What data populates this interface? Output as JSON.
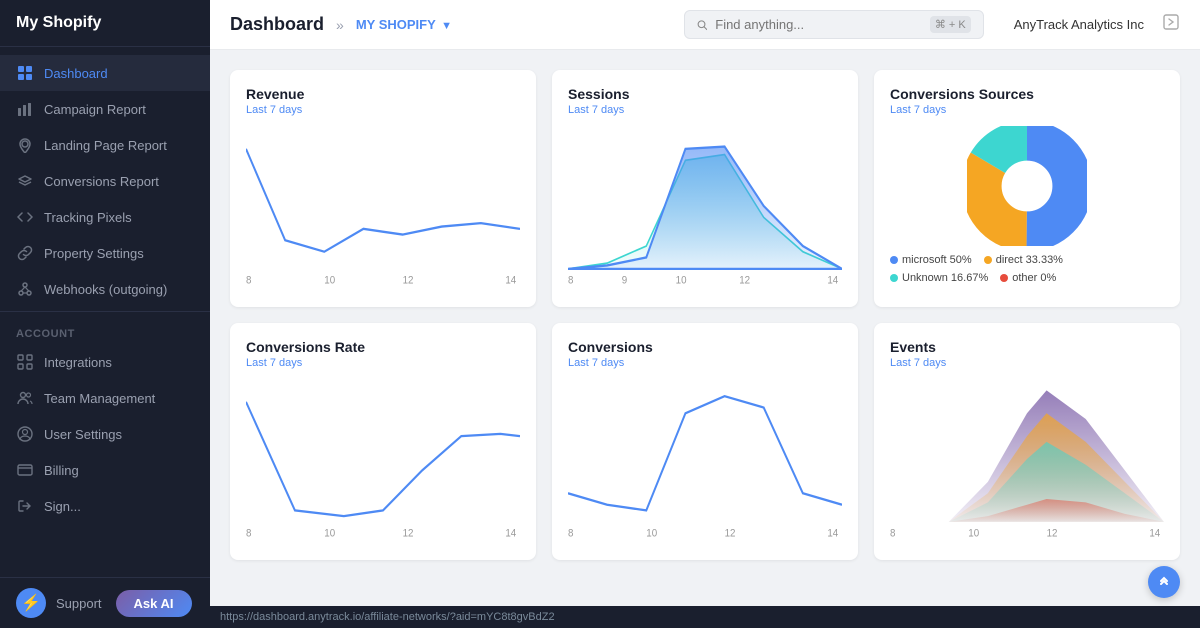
{
  "app": {
    "name": "My Shopify"
  },
  "topbar": {
    "title": "Dashboard",
    "breadcrumb": "MY SHOPIFY",
    "search_placeholder": "Find anything...",
    "search_shortcut": "⌘ + K",
    "user": "AnyTrack Analytics Inc"
  },
  "sidebar": {
    "nav_items": [
      {
        "id": "dashboard",
        "label": "Dashboard",
        "icon": "grid",
        "active": true
      },
      {
        "id": "campaign",
        "label": "Campaign Report",
        "icon": "bar-chart",
        "active": false
      },
      {
        "id": "landing",
        "label": "Landing Page Report",
        "icon": "location",
        "active": false
      },
      {
        "id": "conversions",
        "label": "Conversions Report",
        "icon": "layers",
        "active": false
      },
      {
        "id": "tracking",
        "label": "Tracking Pixels",
        "icon": "code",
        "active": false
      },
      {
        "id": "property",
        "label": "Property Settings",
        "icon": "link",
        "active": false
      },
      {
        "id": "webhooks",
        "label": "Webhooks (outgoing)",
        "icon": "webhook",
        "active": false
      }
    ],
    "account_section": "Account",
    "account_items": [
      {
        "id": "integrations",
        "label": "Integrations",
        "icon": "grid-small"
      },
      {
        "id": "team",
        "label": "Team Management",
        "icon": "users"
      },
      {
        "id": "user-settings",
        "label": "User Settings",
        "icon": "user-circle"
      },
      {
        "id": "billing",
        "label": "Billing",
        "icon": "credit-card"
      },
      {
        "id": "signout",
        "label": "Sign...",
        "icon": "logout"
      }
    ],
    "support_label": "Support",
    "ask_ai_label": "Ask AI"
  },
  "cards": [
    {
      "id": "revenue",
      "title": "Revenue",
      "subtitle": "Last 7 days",
      "type": "line",
      "x_labels": [
        "8",
        "10",
        "12",
        "14"
      ]
    },
    {
      "id": "sessions",
      "title": "Sessions",
      "subtitle": "Last 7 days",
      "type": "area",
      "x_labels": [
        "8",
        "9",
        "10",
        "12",
        "14"
      ]
    },
    {
      "id": "conversion-sources",
      "title": "Conversions Sources",
      "subtitle": "Last 7 days",
      "type": "pie",
      "legend": [
        {
          "label": "microsoft 50%",
          "color": "#4e8af4"
        },
        {
          "label": "direct 33.33%",
          "color": "#f5a623"
        },
        {
          "label": "Unknown 16.67%",
          "color": "#3dd6d0"
        },
        {
          "label": "other 0%",
          "color": "#e74c3c"
        }
      ]
    },
    {
      "id": "conversions-rate",
      "title": "Conversions Rate",
      "subtitle": "Last 7 days",
      "type": "line",
      "x_labels": [
        "8",
        "10",
        "12",
        "14"
      ]
    },
    {
      "id": "conversions",
      "title": "Conversions",
      "subtitle": "Last 7 days",
      "type": "line",
      "x_labels": [
        "8",
        "10",
        "12",
        "14"
      ]
    },
    {
      "id": "events",
      "title": "Events",
      "subtitle": "Last 7 days",
      "type": "multiarea",
      "x_labels": [
        "8",
        "10",
        "12",
        "14"
      ]
    }
  ],
  "status_bar": {
    "url": "https://dashboard.anytrack.io/affiliate-networks/?aid=mYC8t8gvBdZ2"
  }
}
